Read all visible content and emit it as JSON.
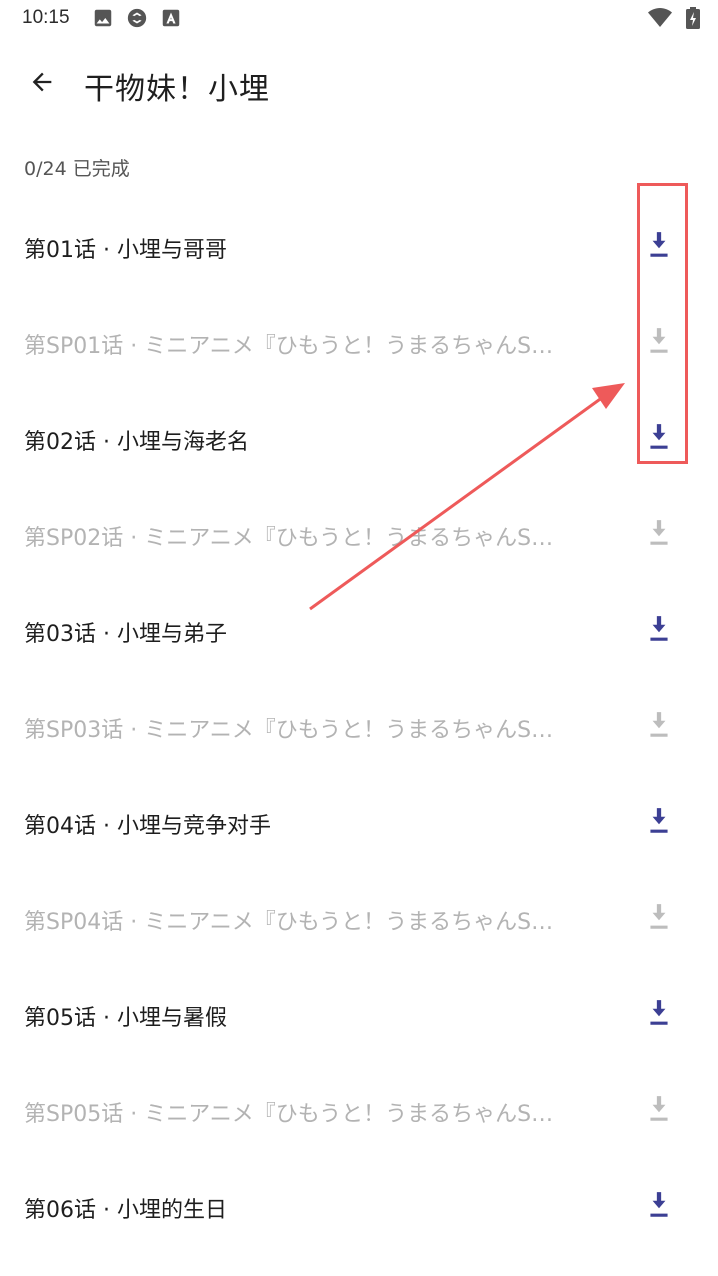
{
  "status_bar": {
    "time": "10:15",
    "left_icons": [
      "image-icon",
      "sync-icon",
      "store-icon"
    ],
    "right_icons": [
      "wifi-icon",
      "battery-charging-icon"
    ]
  },
  "header": {
    "back_icon": "arrow-left-icon",
    "title": "干物妹！小埋"
  },
  "progress": "0/24 已完成",
  "episodes": [
    {
      "title": "第01话 · 小埋与哥哥",
      "enabled": true
    },
    {
      "title": "第SP01话 · ミニアニメ『ひもうと！うまるちゃんS…",
      "enabled": false
    },
    {
      "title": "第02话 · 小埋与海老名",
      "enabled": true
    },
    {
      "title": "第SP02话 · ミニアニメ『ひもうと！うまるちゃんS…",
      "enabled": false
    },
    {
      "title": "第03话 · 小埋与弟子",
      "enabled": true
    },
    {
      "title": "第SP03话 · ミニアニメ『ひもうと！うまるちゃんS…",
      "enabled": false
    },
    {
      "title": "第04话 · 小埋与竞争对手",
      "enabled": true
    },
    {
      "title": "第SP04话 · ミニアニメ『ひもうと！うまるちゃんS…",
      "enabled": false
    },
    {
      "title": "第05话 · 小埋与暑假",
      "enabled": true
    },
    {
      "title": "第SP05话 · ミニアニメ『ひもうと！うまるちゃんS…",
      "enabled": false
    },
    {
      "title": "第06话 · 小埋的生日",
      "enabled": true
    }
  ],
  "colors": {
    "accent": "#3c3f94",
    "disabled": "#bdbdbd",
    "annotation": "#ee5a5a"
  }
}
